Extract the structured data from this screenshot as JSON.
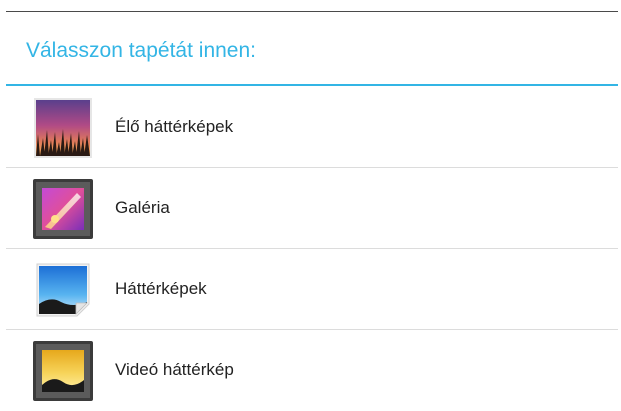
{
  "dialog": {
    "title": "Válasszon tapétát innen:",
    "items": [
      {
        "label": "Élő háttérképek",
        "icon": "live-wallpaper-icon"
      },
      {
        "label": "Galéria",
        "icon": "gallery-icon"
      },
      {
        "label": "Háttérképek",
        "icon": "wallpapers-icon"
      },
      {
        "label": "Videó háttérkép",
        "icon": "video-wallpaper-icon"
      }
    ]
  },
  "colors": {
    "accent": "#33b5e5",
    "text": "#222222",
    "divider": "#dcdcdc"
  }
}
